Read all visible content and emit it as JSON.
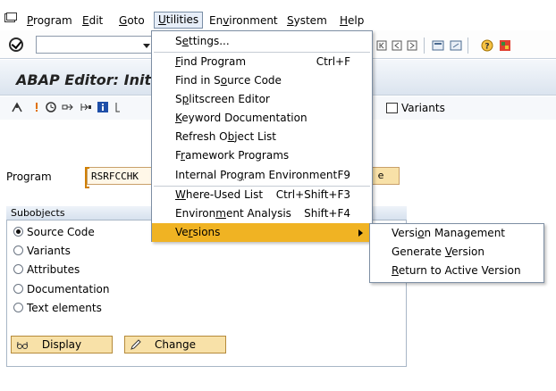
{
  "menubar": {
    "items": [
      {
        "pre": "",
        "u": "P",
        "post": "rogram"
      },
      {
        "pre": "",
        "u": "E",
        "post": "dit"
      },
      {
        "pre": "",
        "u": "G",
        "post": "oto"
      },
      {
        "pre": "",
        "u": "U",
        "post": "tilities"
      },
      {
        "pre": "En",
        "u": "v",
        "post": "ironment"
      },
      {
        "pre": "",
        "u": "S",
        "post": "ystem"
      },
      {
        "pre": "",
        "u": "H",
        "post": "elp"
      }
    ],
    "active_index": 3
  },
  "title": {
    "text": "ABAP Editor: Initia"
  },
  "toolbar2": {
    "variants_label": "Variants"
  },
  "program": {
    "label": "Program",
    "value": "RSRFCCHK",
    "button_label": "e"
  },
  "subobjects": {
    "title": "Subobjects",
    "options": [
      {
        "label": "Source Code",
        "checked": true
      },
      {
        "label": "Variants",
        "checked": false
      },
      {
        "label": "Attributes",
        "checked": false
      },
      {
        "label": "Documentation",
        "checked": false
      },
      {
        "label": "Text elements",
        "checked": false
      }
    ],
    "display_label": "Display",
    "change_label": "Change"
  },
  "utilities_menu": [
    {
      "pre": "S",
      "u": "e",
      "post": "ttings...",
      "shortcut": ""
    },
    {
      "pre": "",
      "u": "F",
      "post": "ind Program",
      "shortcut": "Ctrl+F"
    },
    {
      "pre": "Find in S",
      "u": "o",
      "post": "urce Code",
      "shortcut": ""
    },
    {
      "pre": "S",
      "u": "p",
      "post": "litscreen Editor",
      "shortcut": ""
    },
    {
      "pre": "",
      "u": "K",
      "post": "eyword Documentation",
      "shortcut": ""
    },
    {
      "pre": "Refresh O",
      "u": "b",
      "post": "ject List",
      "shortcut": ""
    },
    {
      "pre": "F",
      "u": "r",
      "post": "amework Programs",
      "shortcut": ""
    },
    {
      "pre": "Internal Pro",
      "u": "g",
      "post": "ram Environment",
      "shortcut": "F9"
    },
    {
      "pre": "",
      "u": "W",
      "post": "here-Used List",
      "shortcut": "Ctrl+Shift+F3"
    },
    {
      "pre": "Environ",
      "u": "m",
      "post": "ent Analysis",
      "shortcut": "Shift+F4"
    },
    {
      "pre": "Ve",
      "u": "r",
      "post": "sions",
      "shortcut": ""
    }
  ],
  "versions_submenu": [
    {
      "pre": "Versi",
      "u": "o",
      "post": "n Management"
    },
    {
      "pre": "Generate ",
      "u": "V",
      "post": "ersion"
    },
    {
      "pre": "",
      "u": "R",
      "post": "eturn to Active Version"
    }
  ],
  "colors": {
    "highlight": "#f0b323",
    "button_fill": "#f8e1a8",
    "title_gradient_bottom": "#dbe4ef"
  }
}
